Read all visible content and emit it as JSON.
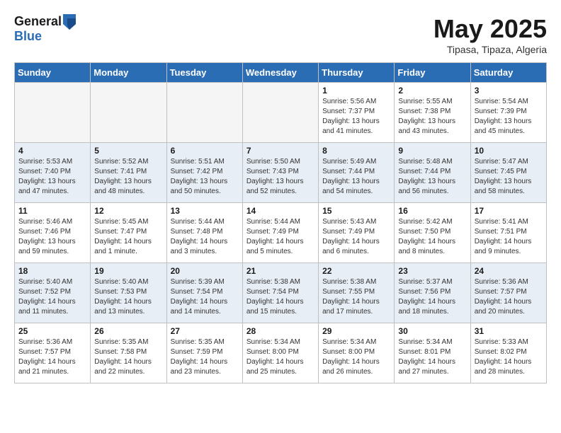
{
  "header": {
    "logo_general": "General",
    "logo_blue": "Blue",
    "title": "May 2025",
    "location": "Tipasa, Tipaza, Algeria"
  },
  "weekdays": [
    "Sunday",
    "Monday",
    "Tuesday",
    "Wednesday",
    "Thursday",
    "Friday",
    "Saturday"
  ],
  "weeks": [
    [
      {
        "day": "",
        "empty": true
      },
      {
        "day": "",
        "empty": true
      },
      {
        "day": "",
        "empty": true
      },
      {
        "day": "",
        "empty": true
      },
      {
        "day": "1",
        "info": "Sunrise: 5:56 AM\nSunset: 7:37 PM\nDaylight: 13 hours\nand 41 minutes."
      },
      {
        "day": "2",
        "info": "Sunrise: 5:55 AM\nSunset: 7:38 PM\nDaylight: 13 hours\nand 43 minutes."
      },
      {
        "day": "3",
        "info": "Sunrise: 5:54 AM\nSunset: 7:39 PM\nDaylight: 13 hours\nand 45 minutes."
      }
    ],
    [
      {
        "day": "4",
        "info": "Sunrise: 5:53 AM\nSunset: 7:40 PM\nDaylight: 13 hours\nand 47 minutes."
      },
      {
        "day": "5",
        "info": "Sunrise: 5:52 AM\nSunset: 7:41 PM\nDaylight: 13 hours\nand 48 minutes."
      },
      {
        "day": "6",
        "info": "Sunrise: 5:51 AM\nSunset: 7:42 PM\nDaylight: 13 hours\nand 50 minutes."
      },
      {
        "day": "7",
        "info": "Sunrise: 5:50 AM\nSunset: 7:43 PM\nDaylight: 13 hours\nand 52 minutes."
      },
      {
        "day": "8",
        "info": "Sunrise: 5:49 AM\nSunset: 7:44 PM\nDaylight: 13 hours\nand 54 minutes."
      },
      {
        "day": "9",
        "info": "Sunrise: 5:48 AM\nSunset: 7:44 PM\nDaylight: 13 hours\nand 56 minutes."
      },
      {
        "day": "10",
        "info": "Sunrise: 5:47 AM\nSunset: 7:45 PM\nDaylight: 13 hours\nand 58 minutes."
      }
    ],
    [
      {
        "day": "11",
        "info": "Sunrise: 5:46 AM\nSunset: 7:46 PM\nDaylight: 13 hours\nand 59 minutes."
      },
      {
        "day": "12",
        "info": "Sunrise: 5:45 AM\nSunset: 7:47 PM\nDaylight: 14 hours\nand 1 minute."
      },
      {
        "day": "13",
        "info": "Sunrise: 5:44 AM\nSunset: 7:48 PM\nDaylight: 14 hours\nand 3 minutes."
      },
      {
        "day": "14",
        "info": "Sunrise: 5:44 AM\nSunset: 7:49 PM\nDaylight: 14 hours\nand 5 minutes."
      },
      {
        "day": "15",
        "info": "Sunrise: 5:43 AM\nSunset: 7:49 PM\nDaylight: 14 hours\nand 6 minutes."
      },
      {
        "day": "16",
        "info": "Sunrise: 5:42 AM\nSunset: 7:50 PM\nDaylight: 14 hours\nand 8 minutes."
      },
      {
        "day": "17",
        "info": "Sunrise: 5:41 AM\nSunset: 7:51 PM\nDaylight: 14 hours\nand 9 minutes."
      }
    ],
    [
      {
        "day": "18",
        "info": "Sunrise: 5:40 AM\nSunset: 7:52 PM\nDaylight: 14 hours\nand 11 minutes."
      },
      {
        "day": "19",
        "info": "Sunrise: 5:40 AM\nSunset: 7:53 PM\nDaylight: 14 hours\nand 13 minutes."
      },
      {
        "day": "20",
        "info": "Sunrise: 5:39 AM\nSunset: 7:54 PM\nDaylight: 14 hours\nand 14 minutes."
      },
      {
        "day": "21",
        "info": "Sunrise: 5:38 AM\nSunset: 7:54 PM\nDaylight: 14 hours\nand 15 minutes."
      },
      {
        "day": "22",
        "info": "Sunrise: 5:38 AM\nSunset: 7:55 PM\nDaylight: 14 hours\nand 17 minutes."
      },
      {
        "day": "23",
        "info": "Sunrise: 5:37 AM\nSunset: 7:56 PM\nDaylight: 14 hours\nand 18 minutes."
      },
      {
        "day": "24",
        "info": "Sunrise: 5:36 AM\nSunset: 7:57 PM\nDaylight: 14 hours\nand 20 minutes."
      }
    ],
    [
      {
        "day": "25",
        "info": "Sunrise: 5:36 AM\nSunset: 7:57 PM\nDaylight: 14 hours\nand 21 minutes."
      },
      {
        "day": "26",
        "info": "Sunrise: 5:35 AM\nSunset: 7:58 PM\nDaylight: 14 hours\nand 22 minutes."
      },
      {
        "day": "27",
        "info": "Sunrise: 5:35 AM\nSunset: 7:59 PM\nDaylight: 14 hours\nand 23 minutes."
      },
      {
        "day": "28",
        "info": "Sunrise: 5:34 AM\nSunset: 8:00 PM\nDaylight: 14 hours\nand 25 minutes."
      },
      {
        "day": "29",
        "info": "Sunrise: 5:34 AM\nSunset: 8:00 PM\nDaylight: 14 hours\nand 26 minutes."
      },
      {
        "day": "30",
        "info": "Sunrise: 5:34 AM\nSunset: 8:01 PM\nDaylight: 14 hours\nand 27 minutes."
      },
      {
        "day": "31",
        "info": "Sunrise: 5:33 AM\nSunset: 8:02 PM\nDaylight: 14 hours\nand 28 minutes."
      }
    ]
  ]
}
